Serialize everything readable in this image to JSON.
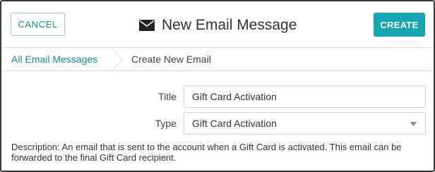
{
  "header": {
    "cancel_label": "CANCEL",
    "title": "New Email Message",
    "create_label": "CREATE"
  },
  "breadcrumb": {
    "parent": "All Email Messages",
    "current": "Create New Email"
  },
  "form": {
    "title_label": "Title",
    "title_value": "Gift Card Activation",
    "type_label": "Type",
    "type_value": "Gift Card Activation"
  },
  "description": "Description: An email that is sent to the account when a Gift Card is activated. This email can be forwarded to the final Gift Card recipient.",
  "icons": {
    "title_icon": "envelope-icon",
    "select_caret": "caret-down-icon",
    "breadcrumb_separator": "chevron-right-icon"
  },
  "colors": {
    "accent": "#17a5b1",
    "link": "#1a8a94",
    "border": "#cfcfcf"
  }
}
